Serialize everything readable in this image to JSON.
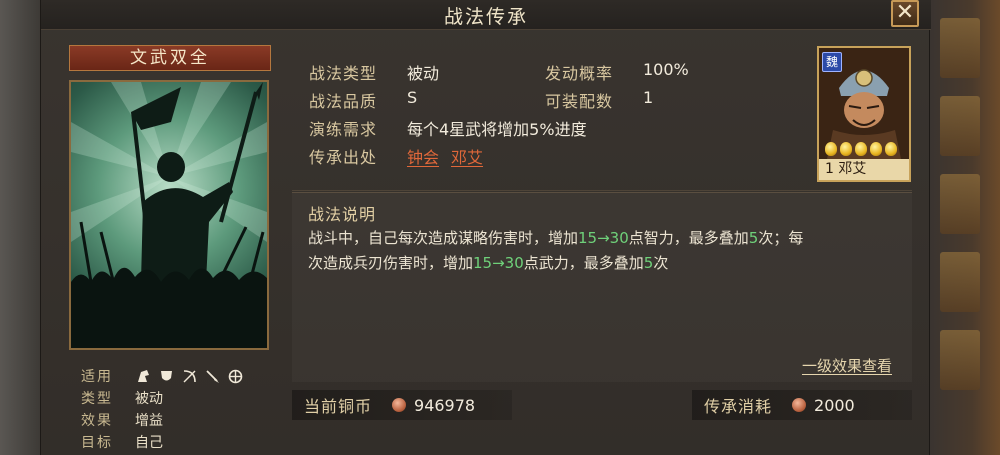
{
  "window": {
    "title": "战法传承",
    "close_label": "✕"
  },
  "skill": {
    "name": "文武双全",
    "attrs": {
      "suitable_label": "适用",
      "troop_icons": [
        "cavalry-icon",
        "shield-icon",
        "archer-icon",
        "spear-icon",
        "siege-icon"
      ],
      "type_label": "类型",
      "type_value": "被动",
      "effect_label": "效果",
      "effect_value": "增益",
      "target_label": "目标",
      "target_value": "自己"
    }
  },
  "info": {
    "type_label": "战法类型",
    "type_value": "被动",
    "rate_label": "发动概率",
    "rate_value": "100%",
    "quality_label": "战法品质",
    "quality_value": "S",
    "slots_label": "可装配数",
    "slots_value": "1",
    "drill_label": "演练需求",
    "drill_value": "每个4星武将增加5%进度",
    "source_label": "传承出处",
    "sources": [
      "钟会",
      "邓艾"
    ]
  },
  "general": {
    "faction": "魏",
    "stars": 5,
    "name": "1 邓艾"
  },
  "description": {
    "title": "战法说明",
    "p1_a": "战斗中，自己每次造成谋略伤害时，增加",
    "p1_hl1": "15→30",
    "p1_b": "点智力，最多叠加",
    "p1_hl2": "5",
    "p1_c": "次；每",
    "p2_a": "次造成兵刃伤害时，增加",
    "p2_hl1": "15→30",
    "p2_b": "点武力，最多叠加",
    "p2_hl2": "5",
    "p2_c": "次",
    "effect_link": "一级效果查看"
  },
  "bottom": {
    "coins_label": "当前铜币",
    "coins_value": "946978",
    "cost_label": "传承消耗",
    "cost_value": "2000"
  },
  "colors": {
    "highlight_green": "#6fd17a",
    "source_link": "#e0683a",
    "banner_red": "#7a2e1c",
    "gold_border": "#c7a25a"
  }
}
